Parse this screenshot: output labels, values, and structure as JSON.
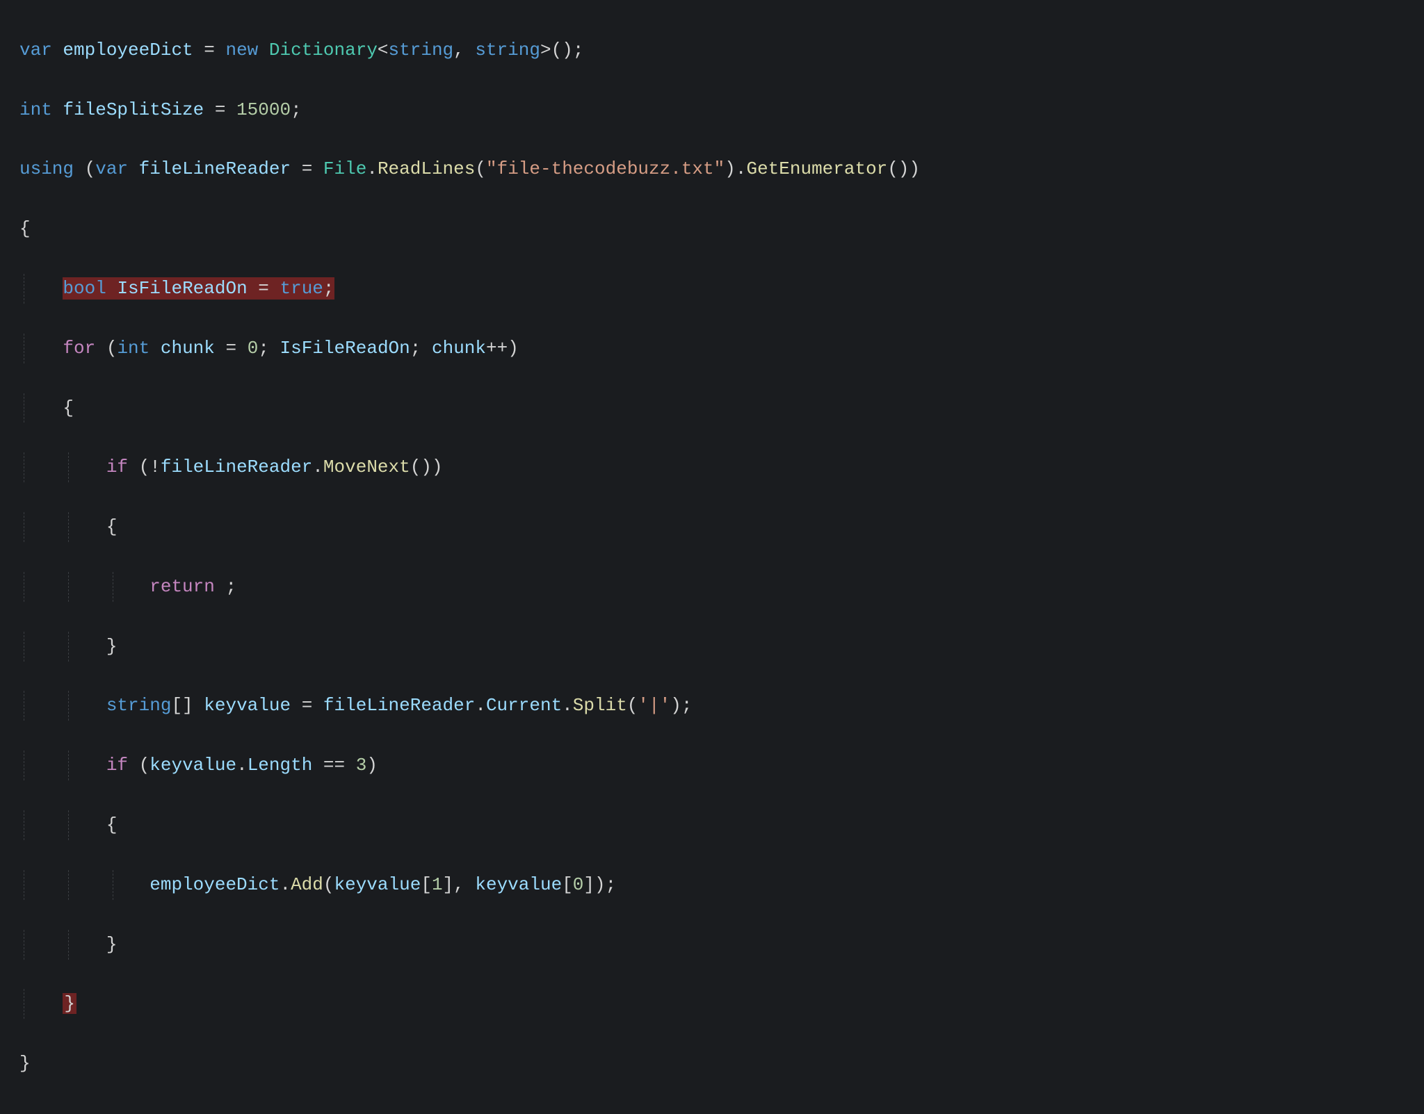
{
  "code": {
    "l1": {
      "var": "var",
      "name": "employeeDict",
      "eq": " = ",
      "new": "new",
      "sp": " ",
      "dict": "Dictionary",
      "lt": "<",
      "str1": "string",
      "comma": ", ",
      "str2": "string",
      "gt": ">",
      "paren": "();"
    },
    "l2": {
      "int": "int",
      "name": "fileSplitSize",
      "eq": " = ",
      "val": "15000",
      "semi": ";"
    },
    "l3": {
      "using": "using",
      "op": " (",
      "var": "var",
      "sp": " ",
      "name": "fileLineReader",
      "eq": " = ",
      "file": "File",
      "dot1": ".",
      "readlines": "ReadLines",
      "op2": "(",
      "fname": "\"file-thecodebuzz.txt\"",
      "cp": ")",
      "dot2": ".",
      "getenum": "GetEnumerator",
      "end": "())"
    },
    "l4": {
      "brace": "{"
    },
    "l5": {
      "bool": "bool",
      "sp": " ",
      "name": "IsFileReadOn",
      "eq": " = ",
      "true": "true",
      "semi": ";"
    },
    "l6": {
      "for": "for",
      "op": " (",
      "int": "int",
      "sp": " ",
      "chunk": "chunk",
      "eq": " = ",
      "zero": "0",
      "semi1": "; ",
      "cond": "IsFileReadOn",
      "semi2": "; ",
      "inc": "chunk",
      "pp": "++)"
    },
    "l7": {
      "brace": "{"
    },
    "l8": {
      "if": "if",
      "op": " (!",
      "name": "fileLineReader",
      "dot": ".",
      "mn": "MoveNext",
      "end": "())"
    },
    "l9": {
      "brace": "{"
    },
    "l10": {
      "ret": "return",
      "sp": " ;"
    },
    "l11": {
      "brace": "}"
    },
    "l12": {
      "str": "string",
      "br": "[] ",
      "name": "keyvalue",
      "eq": " = ",
      "reader": "fileLineReader",
      "dot1": ".",
      "cur": "Current",
      "dot2": ".",
      "split": "Split",
      "op": "(",
      "ch": "'|'",
      "end": ");"
    },
    "l13": {
      "if": "if",
      "op": " (",
      "name": "keyvalue",
      "dot": ".",
      "len": "Length",
      "eqeq": " == ",
      "three": "3",
      "end": ")"
    },
    "l14": {
      "brace": "{"
    },
    "l15": {
      "dict": "employeeDict",
      "dot": ".",
      "add": "Add",
      "op": "(",
      "kv1": "keyvalue",
      "idx1": "[",
      "one": "1",
      "idx1e": "], ",
      "kv2": "keyvalue",
      "idx2": "[",
      "zero": "0",
      "end": "]);"
    },
    "l16": {
      "brace": "}"
    },
    "l17": {
      "brace": "}"
    },
    "l18": {
      "brace": "}"
    }
  }
}
